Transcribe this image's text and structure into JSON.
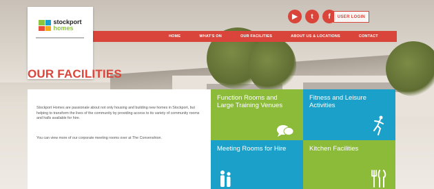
{
  "header": {
    "logo_line1": "stockport",
    "logo_line2": "homes",
    "social": [
      {
        "name": "youtube-icon",
        "glyph": "▶"
      },
      {
        "name": "twitter-icon",
        "glyph": "t"
      },
      {
        "name": "facebook-icon",
        "glyph": "f"
      }
    ],
    "login_label": "USER LOGIN"
  },
  "nav": {
    "items": [
      "HOME",
      "WHAT'S ON",
      "OUR FACILITIES",
      "ABOUT US & LOCATIONS",
      "CONTACT"
    ]
  },
  "page": {
    "title": "OUR FACILITIES"
  },
  "content": {
    "paragraph1": "Stockport Homes are passionate about not only housing and building new homes in Stockport, but helping to transform the lives of the community by providing access to its variety of community rooms and halls available for hire.",
    "paragraph2": "You can view more of our corporate meeting rooms over at The Convenshion."
  },
  "tiles": [
    {
      "title": "Function Rooms and Large Training Venues",
      "icon": "speech-bubble-icon"
    },
    {
      "title": "Fitness and Leisure Activities",
      "icon": "runner-icon"
    },
    {
      "title": "Meeting Rooms for Hire",
      "icon": "people-icon"
    },
    {
      "title": "Kitchen Facilities",
      "icon": "cutlery-icon"
    }
  ],
  "colors": {
    "brand_red": "#d9453a",
    "green": "#8cbb3a",
    "blue": "#1ba0c9"
  }
}
